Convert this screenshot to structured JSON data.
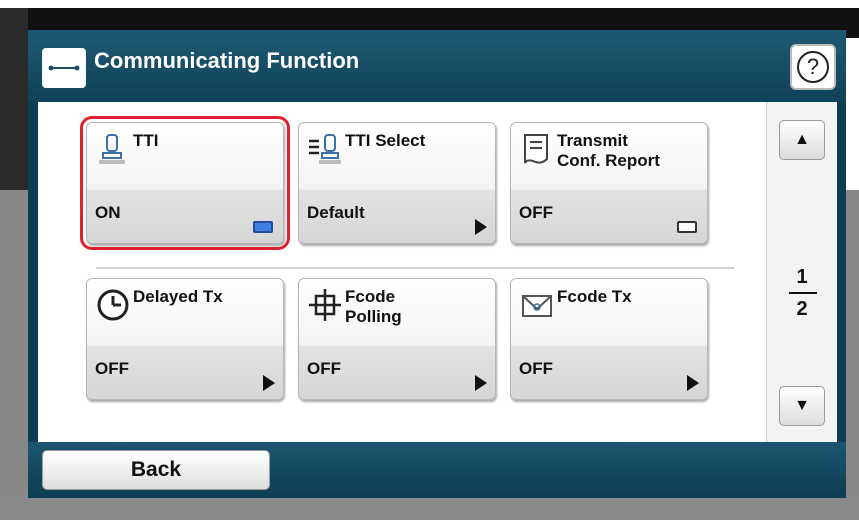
{
  "header": {
    "title": "Communicating Function",
    "help_label": "?"
  },
  "tiles": [
    {
      "label": "TTI",
      "value": "ON",
      "icon": "stamp-icon",
      "control": "toggle-on",
      "selected": true
    },
    {
      "label": "TTI Select",
      "value": "Default",
      "icon": "list-stamp-icon",
      "control": "arrow"
    },
    {
      "label": "Transmit\nConf. Report",
      "value": "OFF",
      "icon": "report-icon",
      "control": "toggle-off"
    },
    {
      "label": "Delayed Tx",
      "value": "OFF",
      "icon": "clock-icon",
      "control": "arrow"
    },
    {
      "label": "Fcode\nPolling",
      "value": "OFF",
      "icon": "crosshair-icon",
      "control": "arrow"
    },
    {
      "label": "Fcode Tx",
      "value": "OFF",
      "icon": "envelope-icon",
      "control": "arrow"
    }
  ],
  "pager": {
    "current": "1",
    "total": "2",
    "up_label": "▲",
    "down_label": "▼"
  },
  "footer": {
    "back_label": "Back"
  },
  "colors": {
    "frame": "#0d3d52",
    "selected_outline": "#e0202e",
    "toggle_on": "#3f7fe0"
  }
}
